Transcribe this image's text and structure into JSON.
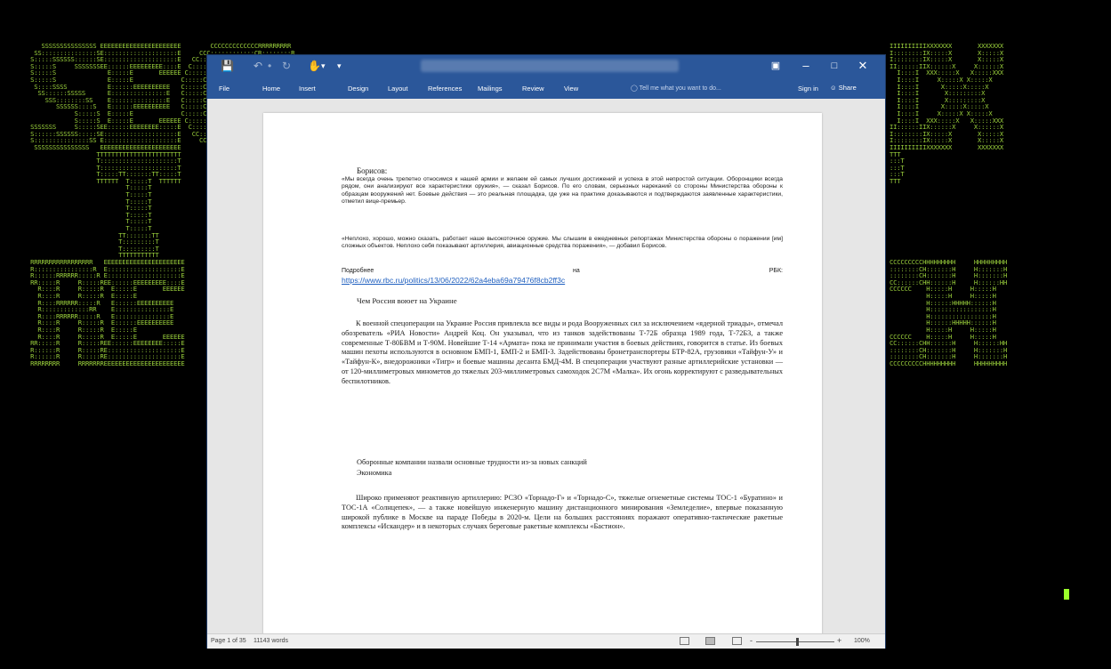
{
  "background": {
    "left_art": "    SSSSSSSSSSSSSSS EEEEEEEEEEEEEEEEEEEEEE        CCCCCCCCCCCCCRRRRRRRRR\n  SS:::::::::::::::SE::::::::::::::::::::E     CCC::::::::::::CR::::::::R\n S:::::SSSSSS::::::SE::::::::::::::::::::E   CC:::::::::::::::CR::::::::R\n S:::::S     SSSSSSSEE::::::EEEEEEEEE::::E  C:::::CCCCCCCC::::CRR:::::R\n S:::::S              E:::::E       EEEEEE C:::::C       CCCCCC  R::::R\n S:::::S              E:::::E             C:::::C                R::::R\n  S::::SSSS           E::::::EEEEEEEEEE   C:::::C                R::::R\n   SS::::::SSSSS      E:::::::::::::::E   C:::::C                R::::R\n     SSS::::::::SS    E:::::::::::::::E   C:::::C                R::::R\n        SSSSSS::::S   E::::::EEEEEEEEEE   C:::::C                R::::R\n             S:::::S  E:::::E             C:::::C                R::::R\n             S:::::S  E:::::E       EEEEEE C:::::C       CCCCCC  R::::R\n SSSSSSS     S:::::SEE::::::EEEEEEEE:::::E  C:::::CCCCCCCC::::CRR:::::R\n S::::::SSSSSS:::::SE::::::::::::::::::::E   CC:::::::::::::::CR::::::::R\n S:::::::::::::::SS E::::::::::::::::::::E     CCC::::::::::::CR::::::::R\n  SSSSSSSSSSSSSSS   EEEEEEEEEEEEEEEEEEEEEE        CCCCCCCCCCCCCRRRRRRRRR\n                   TTTTTTTTTTTTTTTTTTTTTTT\n                   T:::::::::::::::::::::T\n                   T:::::::::::::::::::::T\n                   T:::::TT:::::::TT:::::T\n                   TTTTTT  T:::::T  TTTTTT\n                           T:::::T\n                           T:::::T\n                           T:::::T\n                           T:::::T\n                           T:::::T\n                           T:::::T\n                           T:::::T\n                         TT:::::::TT\n                         T:::::::::T\n                         T:::::::::T\n                         TTTTTTTTTTT\n RRRRRRRRRRRRRRRRR   EEEEEEEEEEEEEEEEEEEEEE\n R::::::::::::::::R  E::::::::::::::::::::E\n R::::::RRRRRR:::::R E::::::::::::::::::::E\n RR:::::R     R:::::REE::::::EEEEEEEEE::::E\n   R::::R     R:::::R  E:::::E       EEEEEE\n   R::::R     R:::::R  E:::::E\n   R::::RRRRRR:::::R   E::::::EEEEEEEEEE\n   R:::::::::::::RR    E:::::::::::::::E\n   R::::RRRRRR:::::R   E:::::::::::::::E\n   R::::R     R:::::R  E::::::EEEEEEEEEE\n   R::::R     R:::::R  E:::::E\n   R::::R     R:::::R  E:::::E       EEEEEE\n RR:::::R     R:::::REE::::::EEEEEEEE:::::E\n R::::::R     R:::::RE::::::::::::::::::::E\n R::::::R     R:::::RE::::::::::::::::::::E\n RRRRRRRR     RRRRRRREEEEEEEEEEEEEEEEEEEEEE",
    "right_art": "IIIIIIIIIIXXXXXXX       XXXXXXX\nI::::::::IX:::::X       X:::::X\nI::::::::IX:::::X       X:::::X\nII::::::IIX::::::X     X::::::X\n  I::::I  XXX:::::X   X:::::XXX\n  I::::I     X:::::X X:::::X\n  I::::I      X:::::X:::::X\n  I::::I       X:::::::::X\n  I::::I       X:::::::::X\n  I::::I      X:::::X:::::X\n  I::::I     X:::::X X:::::X\n  I::::I  XXX:::::X   X:::::XXX\nII::::::IIX::::::X     X::::::X\nI::::::::IX:::::X       X:::::X\nI::::::::IX:::::X       X:::::X\nIIIIIIIIIIXXXXXXX       XXXXXXX\nTTT\n:::T\n:::T\n:::T\nTTT\n\n\n\n\n\n\n\n\n\n\n\nCCCCCCCCCHHHHHHHHH     HHHHHHHHH\n::::::::CH:::::::H     H:::::::H\n::::::::CH:::::::H     H:::::::H\nCC::::::CHH::::::H     H::::::HH\nCCCCCC    H:::::H     H:::::H\n          H:::::H     H:::::H\n          H::::::HHHHH::::::H\n          H:::::::::::::::::H\n          H:::::::::::::::::H\n          H::::::HHHHH::::::H\n          H:::::H     H:::::H\nCCCCCC    H:::::H     H:::::H\nCC::::::CHH::::::H     H::::::HH\n::::::::CH:::::::H     H:::::::H\n::::::::CH:::::::H     H:::::::H\nCCCCCCCCCHHHHHHHHH     HHHHHHHHH"
  },
  "word": {
    "ribbon_tabs": [
      "File",
      "Home",
      "Insert",
      "Design",
      "Layout",
      "References",
      "Mailings",
      "Review",
      "View"
    ],
    "tell_me_placeholder": "Tell me what you want to do...",
    "sign_in": "Sign in",
    "share": "Share",
    "document": {
      "speaker": "Борисов:",
      "quote1": "«Мы всегда очень трепетно относимся к нашей армии и желаем ей самых лучших достижений и успеха в этой непростой ситуации. Оборонщики всегда рядом, они анализируют все характеристики оружия», — сказал Борисов. По его словам, серьезных нареканий со стороны Министерства обороны к образцам вооружений нет. Боевые действия — это реальная площадка, где уже на практике доказываются и подтверждаются заявленные характеристики, отметил вице-премьер.",
      "quote2": "«Неплохо, хорошо, можно сказать, работает наше высокоточное оружие. Мы слышим в ежедневных репортажах Министерства обороны о поражении [им] сложных объектов. Неплохо себя показывают артиллерия, авиационные средства поражения», — добавил Борисов.",
      "more_label": "Подробнее",
      "more_on": "на",
      "more_source": "РБК:",
      "link_url": "https://www.rbc.ru/politics/13/06/2022/62a4eba69a79476f8cb2ff3c",
      "heading1": "Чем Россия воюет на Украине",
      "para1": "К военной спецоперации на Украине Россия привлекла все виды и рода Вооруженных сил за исключением «ядерной триады», отмечал обозреватель «РИА Новости» Андрей Коц. Он указывал, что из танков задействованы Т-72Б образца 1989 года, Т-72Б3, а также современные Т-80БВМ и Т-90М. Новейшие Т-14 «Армата» пока не принимали участия в боевых действиях, говорится в статье. Из боевых машин пехоты используются в основном БМП-1, БМП-2 и БМП-3. Задействованы бронетранспортеры БТР-82А, грузовики «Тайфун-У» и «Тайфун-К», внедорожники «Тигр» и боевые машины десанта БМД-4М. В спецоперации участвуют разные артиллерийские установки — от 120-миллиметровых минометов до тяжелых 203-миллиметровых самоходок 2С7М «Малка». Их огонь корректируют с разведывательных беспилотников.",
      "heading2a": "Оборонные компании назвали основные трудности из-за новых санкций",
      "heading2b": "Экономика",
      "para2": "Широко применяют реактивную артиллерию: РСЗО «Торнадо-Г» и «Торнадо-С», тяжелые огнеметные системы ТОС-1 «Буратино» и ТОС-1А «Солнцепек», — а также новейшую инженерную машину дистанционного минирования «Земледелие», впервые показанную широкой публике в Москве на параде Победы в 2020-м. Цели на больших расстояниях поражают оперативно-тактические ракетные комплексы «Искандер» и в некоторых случаях береговые ракетные комплексы «Бастион»."
    },
    "status": {
      "page": "Page 1 of 35",
      "words": "11143 words",
      "zoom": "100%",
      "zoom_minus": "-",
      "zoom_plus": "+"
    }
  },
  "colors": {
    "ascii": "#9bd13c",
    "word_blue": "#2b579a",
    "link": "#1f5fbf"
  }
}
